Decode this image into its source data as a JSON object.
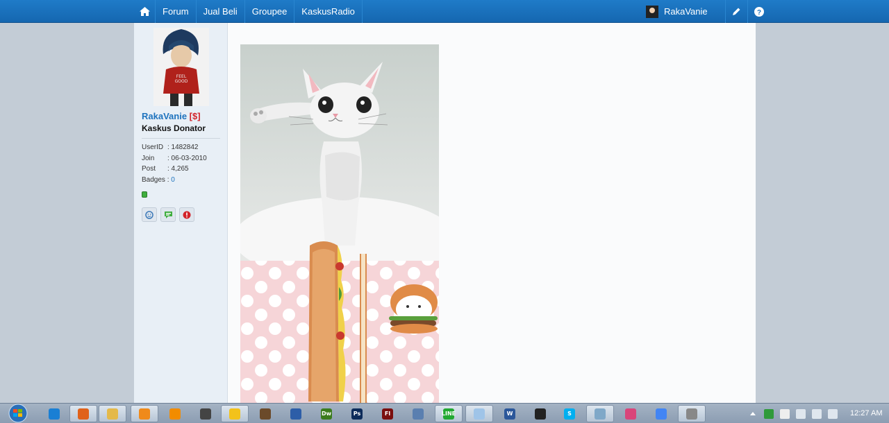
{
  "nav": {
    "items": [
      "Forum",
      "Jual Beli",
      "Groupee",
      "KaskusRadio"
    ],
    "user_name": "RakaVanie"
  },
  "profile": {
    "username": "RakaVanie",
    "donor_tag": "[$]",
    "rank": "Kaskus Donator",
    "stats": [
      {
        "label": "UserID",
        "value": ": 1482842"
      },
      {
        "label": "Join",
        "value": ": 06-03-2010"
      },
      {
        "label": "Post",
        "value": ": 4,265"
      }
    ],
    "badges_label": "Badges :",
    "badges_value": "0"
  },
  "taskbar": {
    "apps": [
      "internet-explorer",
      "firefox",
      "file-explorer",
      "media-player",
      "vlc",
      "media-center",
      "yahoo-messenger",
      "video-editor",
      "network-app",
      "dreamweaver",
      "photoshop",
      "flash",
      "paint",
      "line",
      "notepad",
      "word",
      "mw-app",
      "skype",
      "utility",
      "itunes",
      "chrome",
      "active-app"
    ],
    "labels": {
      "dreamweaver": "Dw",
      "photoshop": "Ps",
      "flash": "Fl",
      "word": "W",
      "skype": "S",
      "line": "LINE"
    },
    "clock": "12:27 AM"
  },
  "colors": {
    "nav_bg": "#1b73c0",
    "link": "#1e73be",
    "donor": "#d2232a",
    "online": "#3fae3f"
  }
}
